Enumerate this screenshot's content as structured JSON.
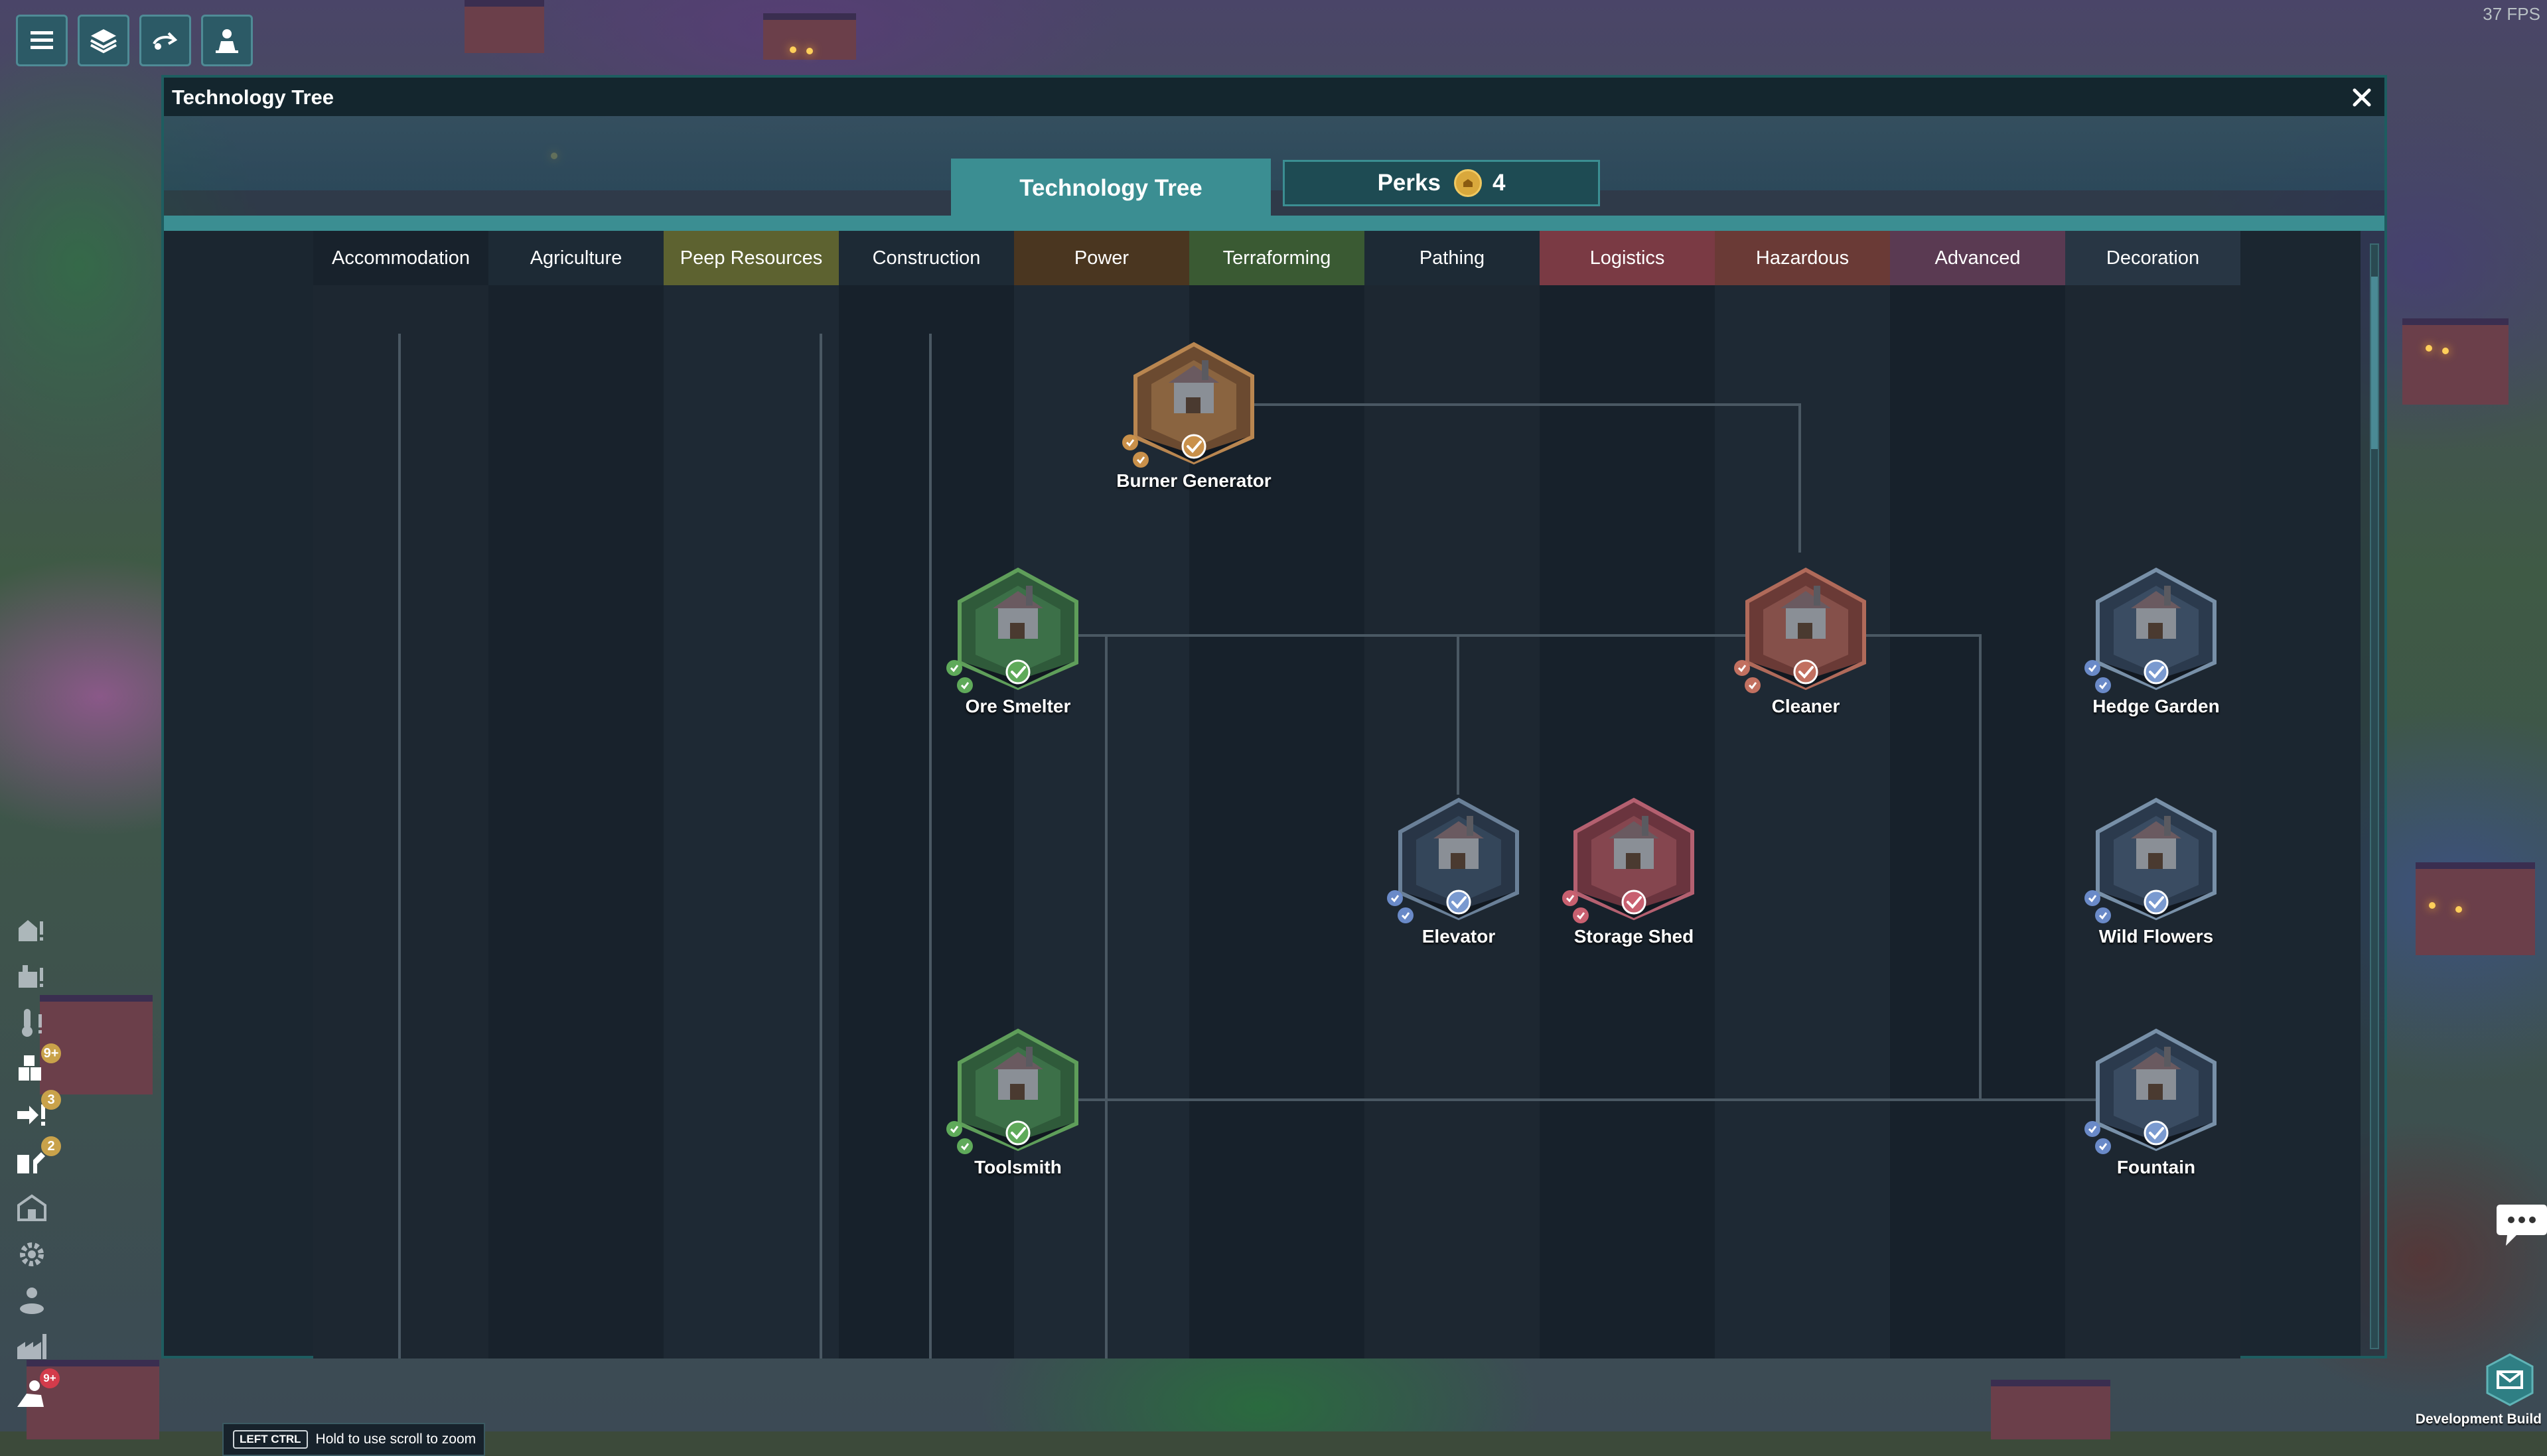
{
  "window": {
    "title": "Technology Tree",
    "tabs": [
      {
        "label": "Technology Tree",
        "active": true
      },
      {
        "label": "Perks",
        "count": "4",
        "active": false
      }
    ]
  },
  "categories": [
    {
      "label": "Accommodation",
      "color": "#18222c"
    },
    {
      "label": "Agriculture",
      "color": "#1d2a35"
    },
    {
      "label": "Peep Resources",
      "color": "#5d6230"
    },
    {
      "label": "Construction",
      "color": "#1d2a35"
    },
    {
      "label": "Power",
      "color": "#4a3620"
    },
    {
      "label": "Terraforming",
      "color": "#3a5a33"
    },
    {
      "label": "Pathing",
      "color": "#1d2a35"
    },
    {
      "label": "Logistics",
      "color": "#7a3a44"
    },
    {
      "label": "Hazardous",
      "color": "#6a3a36"
    },
    {
      "label": "Advanced",
      "color": "#5a3a52"
    },
    {
      "label": "Decoration",
      "color": "#283644"
    }
  ],
  "nodes": [
    {
      "label": "Burner Generator",
      "theme": "power"
    },
    {
      "label": "Ore Smelter",
      "theme": "construction"
    },
    {
      "label": "Cleaner",
      "theme": "hazardous"
    },
    {
      "label": "Hedge Garden",
      "theme": "decoration"
    },
    {
      "label": "Elevator",
      "theme": "pathing"
    },
    {
      "label": "Storage Shed",
      "theme": "logistics"
    },
    {
      "label": "Wild Flowers",
      "theme": "decoration"
    },
    {
      "label": "Toolsmith",
      "theme": "construction"
    },
    {
      "label": "Fountain",
      "theme": "decoration"
    }
  ],
  "hint": {
    "key": "LEFT CTRL",
    "text": "Hold to use scroll to zoom"
  },
  "hud": {
    "fps": "37 FPS",
    "dev_build": "Development Build",
    "badges": [
      "9+",
      "3",
      "2",
      "9+"
    ]
  },
  "colors": {
    "accent": "#3b8e92",
    "window_border": "#1e5d60",
    "content_bg": "#1b2630"
  }
}
